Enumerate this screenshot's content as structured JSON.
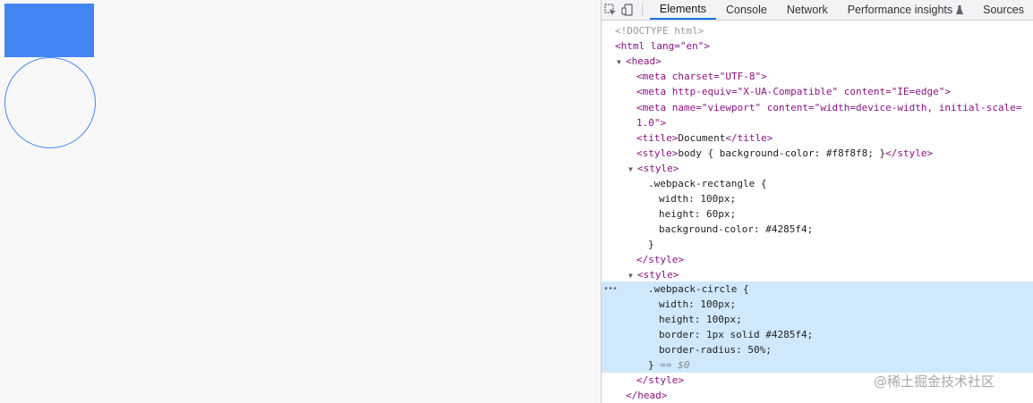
{
  "page": {
    "background": "#f8f8f8",
    "rect_color": "#4285f4",
    "circle_border_color": "#4285f4"
  },
  "devtools": {
    "tabs": [
      "Elements",
      "Console",
      "Network",
      "Performance insights",
      "Sources"
    ],
    "active_tab": "Elements",
    "accent": "#1a73e8",
    "icons": [
      "inspect-element-icon",
      "device-toggle-icon",
      "flask-icon",
      "more-options-icon"
    ],
    "dom": {
      "doctype": "<!DOCTYPE html>",
      "html_open": "<html lang=\"en\">",
      "head_open": "<head>",
      "meta_charset": "<meta charset=\"UTF-8\">",
      "meta_compat": "<meta http-equiv=\"X-UA-Compatible\" content=\"IE=edge\">",
      "meta_viewport_1": "<meta name=\"viewport\" content=\"width=device-width, initial-scale=",
      "meta_viewport_2": "1.0\">",
      "title_open": "<title>",
      "title_text": "Document",
      "title_close": "</title>",
      "style_inline_open": "<style>",
      "style_inline_text": "body { background-color: #f8f8f8; }",
      "style_inline_close": "</style>",
      "style1_open": "<style>",
      "style1_selector": ".webpack-rectangle {",
      "style1_rules": [
        "width: 100px;",
        "height: 60px;",
        "background-color: #4285f4;"
      ],
      "style1_brace": "}",
      "style1_close": "</style>",
      "style2_open": "<style>",
      "style2_selector": ".webpack-circle {",
      "style2_rules": [
        "width: 100px;",
        "height: 100px;",
        "border: 1px solid #4285f4;",
        "border-radius: 50%;"
      ],
      "style2_brace": "}",
      "style2_dollar": "== $0",
      "style2_close": "</style>",
      "head_close": "</head>",
      "more_dots": "•••"
    }
  },
  "watermark": "@稀土掘金技术社区"
}
